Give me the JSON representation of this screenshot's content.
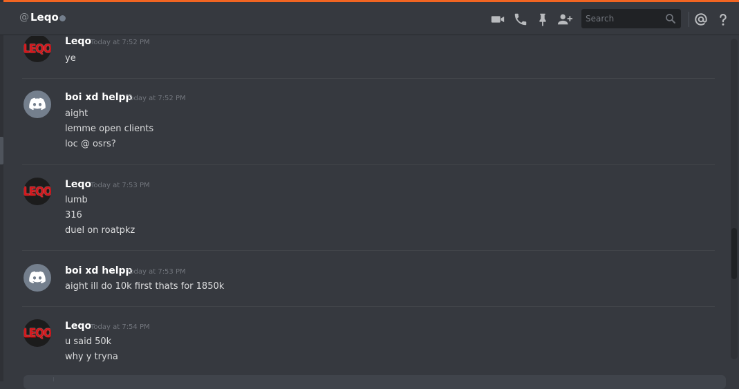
{
  "header": {
    "at_symbol": "@",
    "channel_name": "Leqo",
    "status": "offline",
    "icons": [
      "video-call-icon",
      "voice-call-icon",
      "pin-icon",
      "add-friend-icon",
      "mention-icon",
      "help-icon"
    ],
    "search_placeholder": "Search"
  },
  "colors": {
    "accent_bar": "#f26522",
    "background": "#36393f",
    "username": "#ffffff",
    "timestamp": "#72767d"
  },
  "messages": [
    {
      "author": "Leqo",
      "avatar": "leqo-avatar",
      "timestamp": "Today at 7:52 PM",
      "lines": [
        "ye"
      ]
    },
    {
      "author": "boi xd helpp",
      "avatar": "discord-default-avatar",
      "timestamp": "Today at 7:52 PM",
      "lines": [
        "aight",
        "lemme open clients",
        "loc @ osrs?"
      ]
    },
    {
      "author": "Leqo",
      "avatar": "leqo-avatar",
      "timestamp": "Today at 7:53 PM",
      "lines": [
        "lumb",
        "316",
        "duel on roatpkz"
      ]
    },
    {
      "author": "boi xd helpp",
      "avatar": "discord-default-avatar",
      "timestamp": "Today at 7:53 PM",
      "lines": [
        "aight ill do 10k first thats for 1850k"
      ]
    },
    {
      "author": "Leqo",
      "avatar": "leqo-avatar",
      "timestamp": "Today at 7:54 PM",
      "lines": [
        "u said 50k",
        "why y tryna"
      ]
    }
  ],
  "avatar_text": {
    "leqo": "LEQO"
  }
}
